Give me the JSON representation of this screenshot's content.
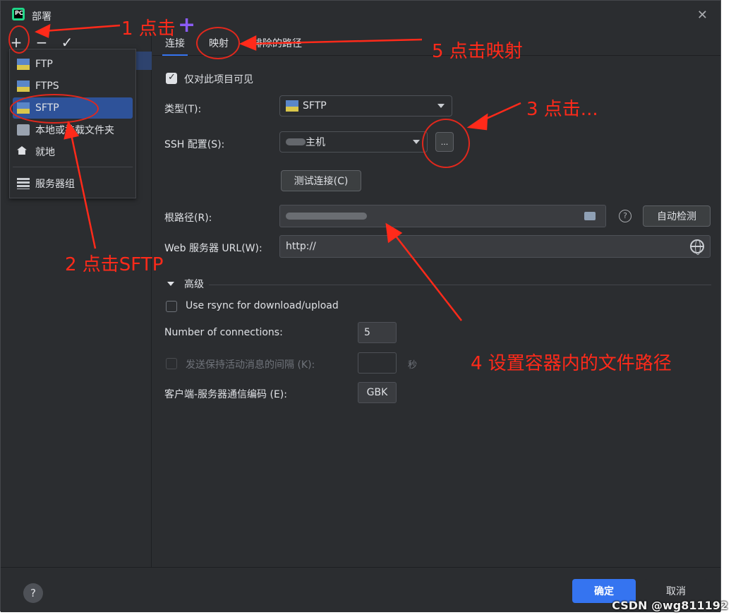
{
  "window": {
    "title": "部署",
    "close_icon": "close-icon"
  },
  "toolbar": {
    "add": "+",
    "remove": "−",
    "apply": "✓"
  },
  "popup_menu": {
    "items": [
      {
        "label": "FTP",
        "icon": "ftp-icon"
      },
      {
        "label": "FTPS",
        "icon": "ftps-icon"
      },
      {
        "label": "SFTP",
        "icon": "sftp-icon",
        "selected": true
      },
      {
        "label": "本地或挂载文件夹",
        "icon": "folder-icon"
      },
      {
        "label": "就地",
        "icon": "home-icon"
      },
      {
        "label": "服务器组",
        "icon": "server-group-icon"
      }
    ]
  },
  "tabs": [
    {
      "label": "连接",
      "active": true
    },
    {
      "label": "映射",
      "active": false
    },
    {
      "label": "排除的路径",
      "active": false
    }
  ],
  "form": {
    "visible_only_project": {
      "label": "仅对此项目可见",
      "checked": true
    },
    "type": {
      "label": "类型(T):",
      "value": "SFTP"
    },
    "ssh_config": {
      "label": "SSH 配置(S):",
      "value": "主机",
      "more_button": "..."
    },
    "test_connection": "测试连接(C)",
    "root_path": {
      "label": "根路径(R):",
      "auto_detect": "自动检测"
    },
    "web_url": {
      "label": "Web 服务器 URL(W):",
      "value": "http://"
    },
    "advanced": {
      "label": "高级"
    },
    "rsync": {
      "label": "Use rsync for download/upload",
      "checked": false
    },
    "connections": {
      "label": "Number of connections:",
      "value": "5"
    },
    "keepalive": {
      "label": "发送保持活动消息的间隔 (K):",
      "unit": "秒",
      "value": ""
    },
    "encoding": {
      "label": "客户端-服务器通信编码 (E):",
      "value": "GBK"
    }
  },
  "footer": {
    "help": "?",
    "ok": "确定",
    "cancel": "取消"
  },
  "annotations": {
    "a1": "1 点击",
    "a2": "2 点击SFTP",
    "a3": "3 点击...",
    "a4": "4 设置容器内的文件路径",
    "a5": "5 点击映射",
    "plus": "+"
  },
  "watermark": "CSDN @wg811192",
  "colors": {
    "accent": "#3574f0",
    "annotation": "#ff2a1a",
    "background": "#2b2d30"
  }
}
